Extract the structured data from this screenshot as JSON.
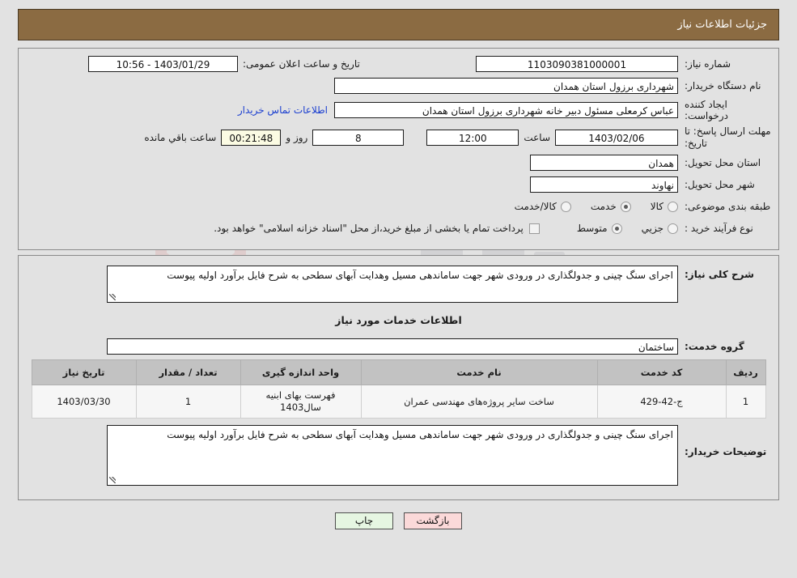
{
  "header": {
    "title": "جزئیات اطلاعات نیاز"
  },
  "form": {
    "need_number": {
      "label": "شماره نیاز:",
      "value": "1103090381000001"
    },
    "announce_datetime": {
      "label": "تاریخ و ساعت اعلان عمومی:",
      "value": "1403/01/29 - 10:56"
    },
    "buyer_org": {
      "label": "نام دستگاه خریدار:",
      "value": "شهرداری برزول استان همدان"
    },
    "request_creator": {
      "label": "ایجاد کننده درخواست:",
      "value": "عباس  کرمعلی مسئول دبیر خانه شهرداری برزول استان همدان"
    },
    "buyer_contact_link": "اطلاعات تماس خریدار",
    "deadline": {
      "label": "مهلت ارسال پاسخ: تا تاریخ:",
      "date": "1403/02/06",
      "time_label": "ساعت",
      "time": "12:00",
      "days": "8",
      "days_suffix": "روز و",
      "countdown": "00:21:48",
      "countdown_suffix": "ساعت باقي مانده"
    },
    "delivery_province": {
      "label": "استان محل تحویل:",
      "value": "همدان"
    },
    "delivery_city": {
      "label": "شهر محل تحویل:",
      "value": "نهاوند"
    },
    "category": {
      "label": "طبقه بندی موضوعی:",
      "options": [
        {
          "label": "کالا",
          "selected": false
        },
        {
          "label": "خدمت",
          "selected": true
        },
        {
          "label": "کالا/خدمت",
          "selected": false
        }
      ]
    },
    "purchase_process": {
      "label": "نوع فرآیند خرید :",
      "options": [
        {
          "label": "جزیي",
          "selected": false
        },
        {
          "label": "متوسط",
          "selected": true
        }
      ]
    },
    "treasury_note": {
      "checked": false,
      "text": "پرداخت تمام یا بخشی از مبلغ خرید،از محل \"اسناد خزانه اسلامی\" خواهد بود."
    }
  },
  "detail": {
    "general_desc": {
      "label": "شرح کلی نیاز:",
      "value": "اجرای سنگ چینی و جدولگذاری در ورودی شهر جهت ساماندهی مسیل وهدایت آبهای سطحی به شرح فایل برآورد اولیه پیوست"
    },
    "services_section_title": "اطلاعات خدمات مورد نیاز",
    "service_group": {
      "label": "گروه خدمت:",
      "value": "ساختمان"
    },
    "table": {
      "columns": [
        "ردیف",
        "کد خدمت",
        "نام خدمت",
        "واحد اندازه گیری",
        "تعداد / مقدار",
        "تاریخ نیاز"
      ],
      "rows": [
        {
          "row_no": "1",
          "service_code": "ج-42-429",
          "service_name": "ساخت سایر پروژه‌های مهندسی عمران",
          "unit": "فهرست بهای ابنیه سال1403",
          "quantity": "1",
          "need_date": "1403/03/30"
        }
      ]
    },
    "buyer_notes": {
      "label": "توضیحات خریدار:",
      "value": "اجرای سنگ چینی و جدولگذاری در ورودی شهر جهت ساماندهی مسیل وهدایت آبهای سطحی به شرح فایل برآورد اولیه پیوست"
    }
  },
  "footer": {
    "print_button": "چاپ",
    "back_button": "بازگشت"
  },
  "watermark": {
    "text": "AniaTender.net"
  },
  "colors": {
    "header_bg": "#8b6b42",
    "page_bg": "#e2e2e2",
    "link": "#1b3fd0",
    "table_header_bg": "#c2c2c2",
    "countdown_bg": "#fbfbe3",
    "print_btn_bg": "#e6f6e2",
    "back_btn_bg": "#fbd9d9"
  }
}
